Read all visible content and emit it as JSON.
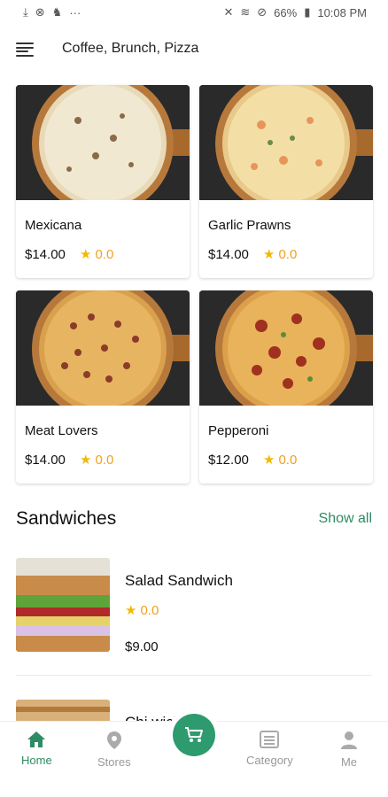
{
  "status_bar": {
    "battery": "66%",
    "time": "10:08 PM"
  },
  "header": {
    "title": "Coffee, Brunch, Pizza"
  },
  "products": [
    {
      "name": "Mexicana",
      "price": "$14.00",
      "rating": "0.0"
    },
    {
      "name": "Garlic Prawns",
      "price": "$14.00",
      "rating": "0.0"
    },
    {
      "name": "Meat Lovers",
      "price": "$14.00",
      "rating": "0.0"
    },
    {
      "name": "Pepperoni",
      "price": "$12.00",
      "rating": "0.0"
    }
  ],
  "section": {
    "title": "Sandwiches",
    "show_all": "Show all"
  },
  "sandwiches": [
    {
      "name": "Salad Sandwich",
      "rating": "0.0",
      "price": "$9.00"
    },
    {
      "name": "Chi           wich"
    }
  ],
  "nav": {
    "home": "Home",
    "stores": "Stores",
    "category": "Category",
    "me": "Me"
  },
  "colors": {
    "accent": "#2e8b63",
    "star": "#f5b800",
    "rating_text": "#f0a020"
  }
}
